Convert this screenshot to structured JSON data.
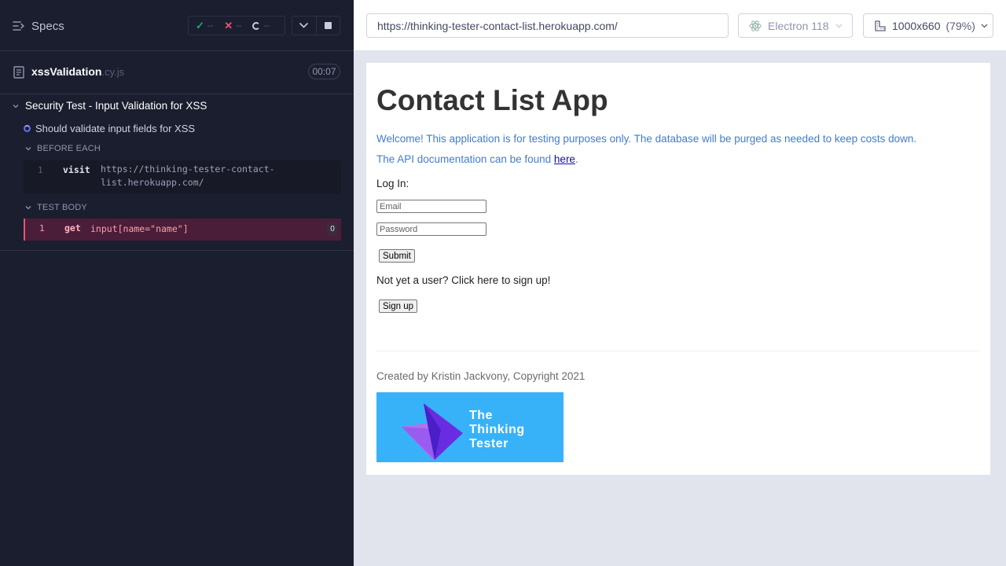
{
  "runner": {
    "specs_label": "Specs",
    "stats": {
      "passed": "--",
      "failed": "--",
      "pending": "--"
    },
    "spec_file": {
      "name": "xssValidation",
      "ext": ".cy.js",
      "duration": "00:07"
    },
    "suite": {
      "title": "Security Test - Input Validation for XSS",
      "test": "Should validate input fields for XSS",
      "before_each": {
        "label": "BEFORE EACH",
        "commands": [
          {
            "num": "1",
            "name": "visit",
            "arg": "https://thinking-tester-contact-list.herokuapp.com/"
          }
        ]
      },
      "test_body": {
        "label": "TEST BODY",
        "commands": [
          {
            "num": "1",
            "name": "get",
            "arg": "input[name=\"name\"]",
            "count": "0"
          }
        ]
      }
    }
  },
  "browser": {
    "url": "https://thinking-tester-contact-list.herokuapp.com/",
    "browser_name": "Electron 118",
    "viewport": "1000x660",
    "zoom": "(79%)"
  },
  "app": {
    "title": "Contact List App",
    "welcome": "Welcome! This application is for testing purposes only. The database will be purged as needed to keep costs down.",
    "api_doc_prefix": "The API documentation can be found ",
    "api_doc_link": "here",
    "api_doc_suffix": ".",
    "login_label": "Log In:",
    "email_placeholder": "Email",
    "password_placeholder": "Password",
    "submit_label": "Submit",
    "signup_prompt": "Not yet a user? Click here to sign up!",
    "signup_label": "Sign up",
    "footer": "Created by Kristin Jackvony, Copyright 2021",
    "logo_lines": [
      "The",
      "Thinking",
      "Tester"
    ]
  },
  "colors": {
    "runner_bg": "#1b1e2e",
    "passed": "#1fa971",
    "failed": "#e45770",
    "link_blue": "#3f7dd1",
    "logo_bg": "#37b2f8"
  }
}
